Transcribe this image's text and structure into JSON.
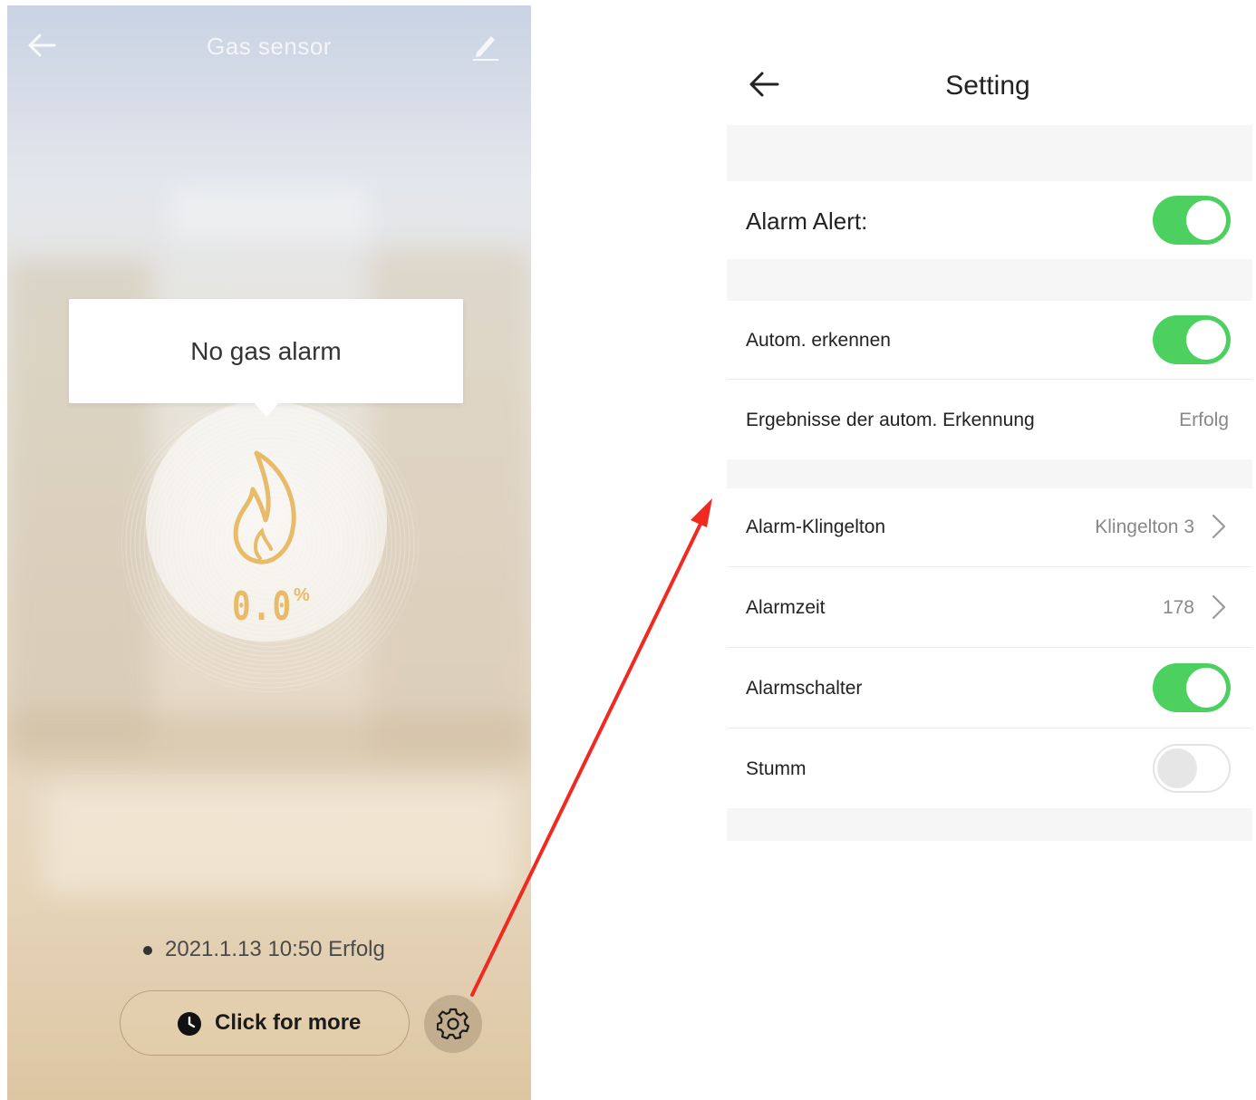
{
  "left_screen": {
    "title": "Gas sensor",
    "status_message": "No gas alarm",
    "gas_value": "0.0",
    "gas_unit": "%",
    "timestamp": "2021.1.13 10:50 Erfolg",
    "more_button_label": "Click for more",
    "icons": {
      "back": "back-arrow-icon",
      "edit": "edit-pencil-icon",
      "flame": "flame-icon",
      "clock": "clock-icon",
      "settings": "gear-icon"
    },
    "colors": {
      "accent": "#e8bb6a"
    }
  },
  "settings_screen": {
    "title": "Setting",
    "rows": [
      {
        "label": "Alarm Alert:",
        "type": "toggle",
        "on": true
      },
      {
        "label": "Autom. erkennen",
        "type": "toggle",
        "on": true
      },
      {
        "label": "Ergebnisse der autom. Erkennung",
        "type": "value",
        "value": "Erfolg"
      },
      {
        "label": "Alarm-Klingelton",
        "type": "link",
        "value": "Klingelton 3"
      },
      {
        "label": "Alarmzeit",
        "type": "link",
        "value": "178"
      },
      {
        "label": "Alarmschalter",
        "type": "toggle",
        "on": true
      },
      {
        "label": "Stumm",
        "type": "toggle",
        "on": false
      }
    ],
    "colors": {
      "toggle_on": "#4cd05f",
      "annotation_arrow": "#f02a21"
    }
  }
}
